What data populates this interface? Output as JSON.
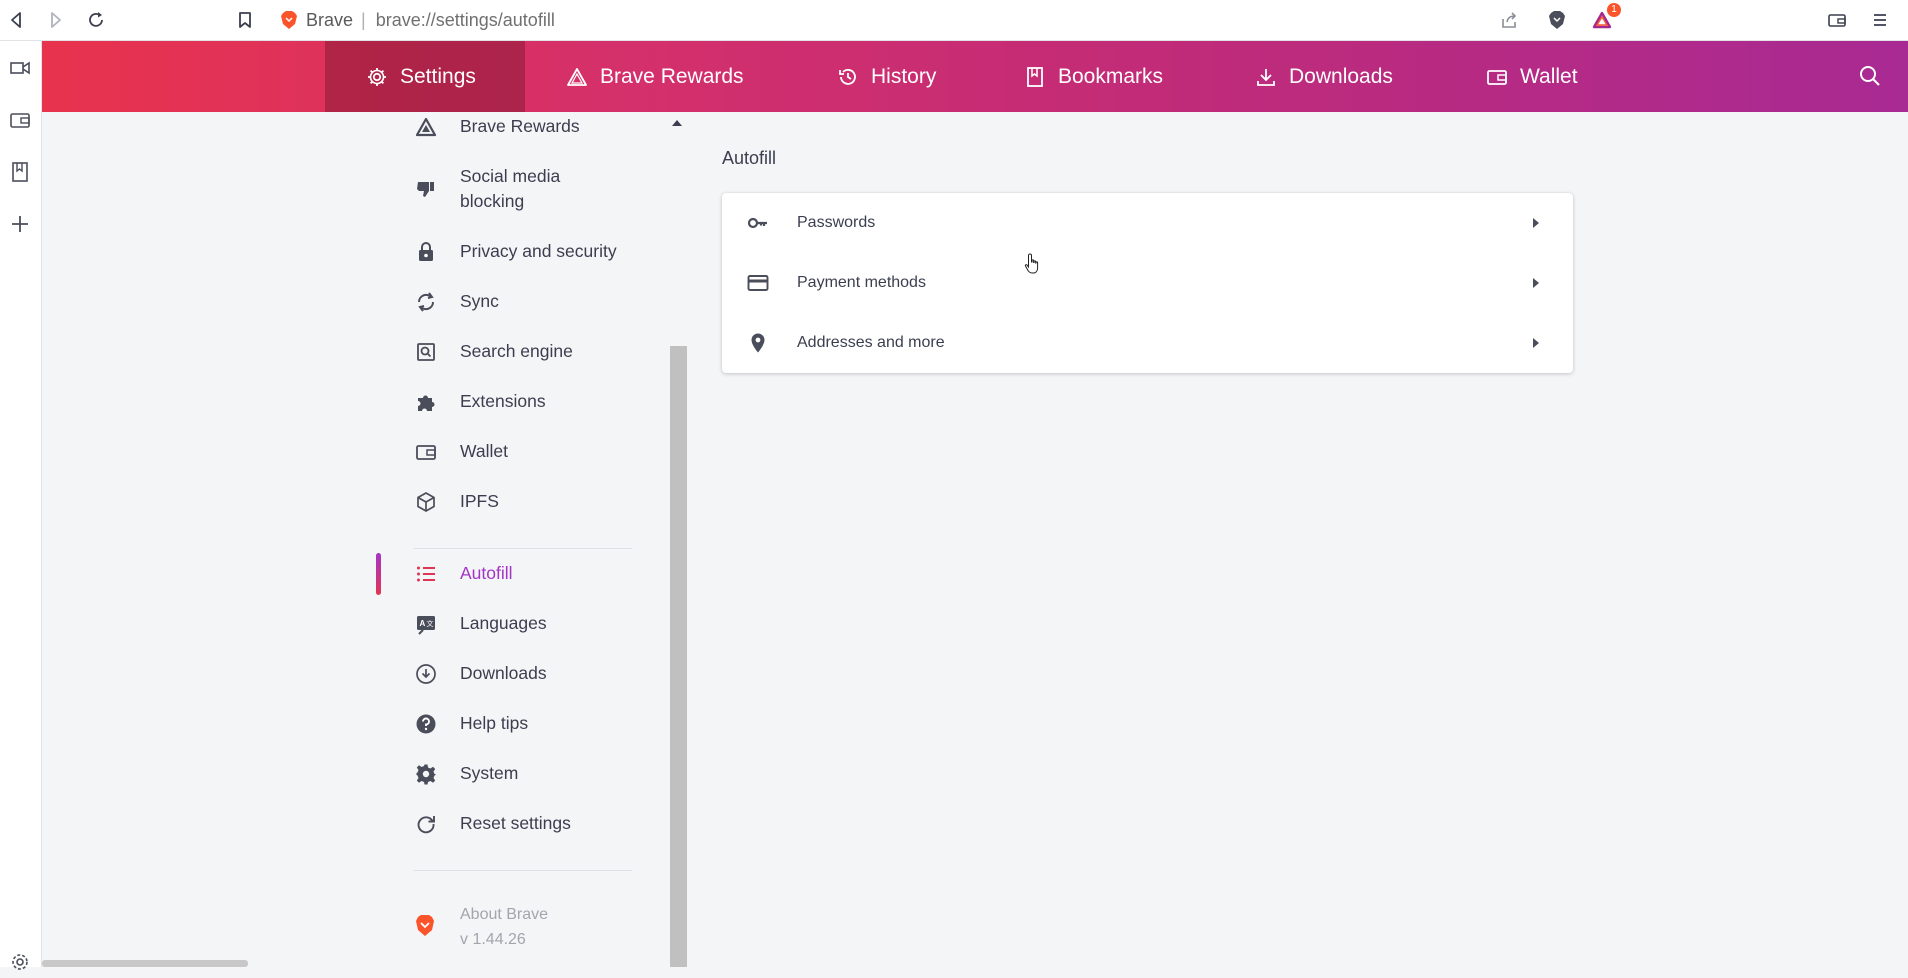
{
  "browser": {
    "brand_name": "Brave",
    "url": "brave://settings/autofill",
    "rewards_badge_count": "1"
  },
  "topnav": {
    "items": [
      {
        "label": "Settings",
        "icon": "gear-icon",
        "active": true
      },
      {
        "label": "Brave Rewards",
        "icon": "triangle-icon",
        "active": false
      },
      {
        "label": "History",
        "icon": "history-icon",
        "active": false
      },
      {
        "label": "Bookmarks",
        "icon": "bookmark-icon",
        "active": false
      },
      {
        "label": "Downloads",
        "icon": "download-icon",
        "active": false
      },
      {
        "label": "Wallet",
        "icon": "wallet-icon",
        "active": false
      }
    ]
  },
  "settings_nav": {
    "items": [
      {
        "label": "Brave Rewards",
        "icon": "brave-rewards-icon"
      },
      {
        "label": "Social media blocking",
        "icon": "thumbs-down-icon"
      },
      {
        "label": "Privacy and security",
        "icon": "lock-icon"
      },
      {
        "label": "Sync",
        "icon": "sync-icon"
      },
      {
        "label": "Search engine",
        "icon": "search-engine-icon"
      },
      {
        "label": "Extensions",
        "icon": "puzzle-icon"
      },
      {
        "label": "Wallet",
        "icon": "wallet-icon"
      },
      {
        "label": "IPFS",
        "icon": "cube-icon"
      },
      {
        "label": "Autofill",
        "icon": "list-icon",
        "active": true
      },
      {
        "label": "Languages",
        "icon": "languages-icon"
      },
      {
        "label": "Downloads",
        "icon": "download-icon"
      },
      {
        "label": "Help tips",
        "icon": "help-icon"
      },
      {
        "label": "System",
        "icon": "gear-icon"
      },
      {
        "label": "Reset settings",
        "icon": "reset-icon"
      }
    ],
    "about": {
      "label": "About Brave",
      "version": "v 1.44.26"
    }
  },
  "main": {
    "section_title": "Autofill",
    "rows": [
      {
        "label": "Passwords",
        "icon": "key-icon"
      },
      {
        "label": "Payment methods",
        "icon": "credit-card-icon"
      },
      {
        "label": "Addresses and more",
        "icon": "location-pin-icon"
      }
    ]
  },
  "colors": {
    "header_gradient_start": "#e8334d",
    "header_gradient_end": "#a82a93",
    "active_accent": "#a434c7"
  }
}
